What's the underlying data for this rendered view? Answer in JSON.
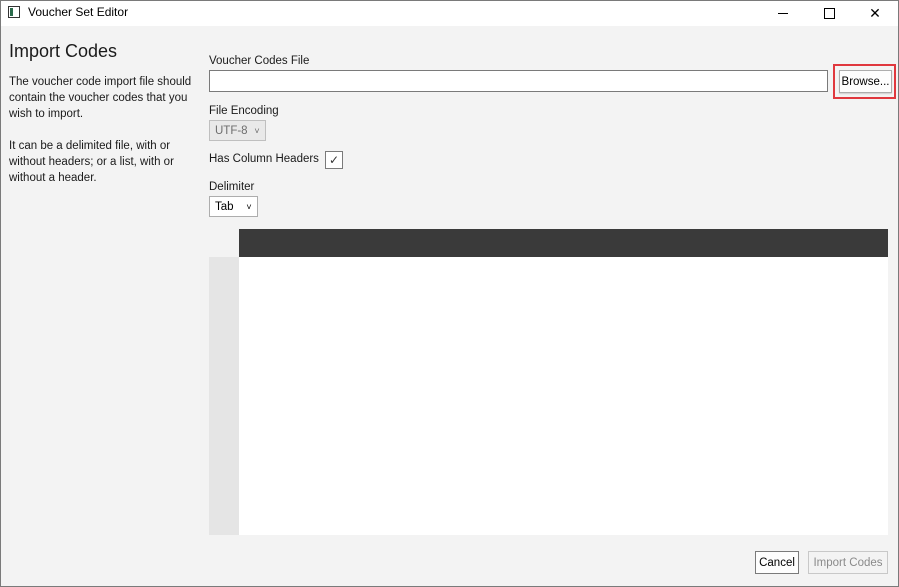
{
  "window": {
    "title": "Voucher Set Editor",
    "minimize_glyph": "",
    "maximize_glyph": "",
    "close_glyph": "✕"
  },
  "info": {
    "title": "Import Codes",
    "paragraph1": "The voucher code import file should contain the voucher codes that you wish to import.",
    "paragraph2": "It can be a delimited file, with or without headers; or a list, with or without a header."
  },
  "form": {
    "file_label": "Voucher Codes File",
    "file_value": "",
    "browse_label": "Browse...",
    "encoding_label": "File Encoding",
    "encoding_value": "UTF-8",
    "has_headers_label": "Has Column Headers",
    "has_headers_checked": true,
    "check_glyph": "✓",
    "delimiter_label": "Delimiter",
    "delimiter_value": "Tab",
    "chevron_glyph": "˅"
  },
  "actions": {
    "cancel_label": "Cancel",
    "import_label": "Import Codes"
  },
  "colors": {
    "highlight": "#e0383e",
    "grid_header": "#3a3a3a",
    "row_header": "#e5e5e5"
  }
}
